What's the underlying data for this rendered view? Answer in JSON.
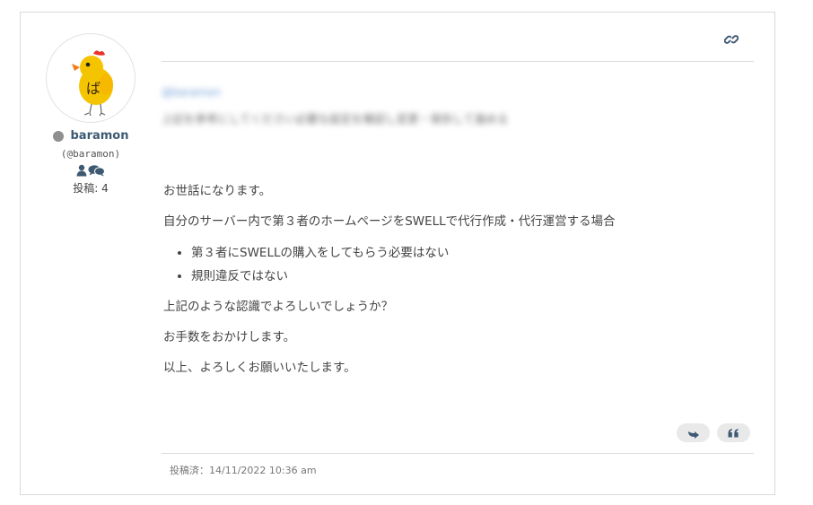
{
  "author": {
    "display_name": "baramon",
    "handle": "(@baramon)",
    "post_count_label": "投稿: 4",
    "status": "offline",
    "avatar_icon": "chick-avatar-icon",
    "avatar_glyph": "ば"
  },
  "toolbar": {
    "link_icon": "link-icon",
    "reply_icon": "reply-arrow-icon",
    "quote_icon": "quote-icon"
  },
  "quote": {
    "author": "@baramon",
    "text": "上記を参考にしてください必要な設定を確認し変更・保存して進める"
  },
  "body": {
    "greeting": "お世話になります。",
    "intro": "自分のサーバー内で第３者のホームページをSWELLで代行作成・代行運営する場合",
    "bullets": [
      "第３者にSWELLの購入をしてもらう必要はない",
      "規則違反ではない"
    ],
    "question": "上記のような認識でよろしいでしょうか？",
    "thanks": "お手数をおかけします。",
    "closing": "以上、よろしくお願いいたします。"
  },
  "meta": {
    "posted_label": "投稿済：14/11/2022 10:36 am"
  },
  "colors": {
    "name": "#3e5a73",
    "status_dot": "#8f8f8f",
    "icon": "#3e5a73",
    "button_bg": "#e9e9e9"
  }
}
